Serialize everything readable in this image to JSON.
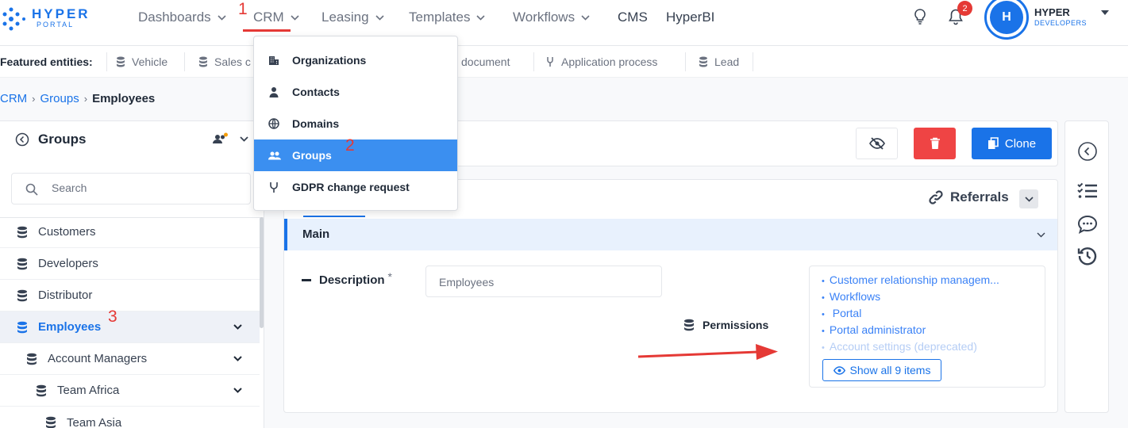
{
  "logo": {
    "title": "HYPER",
    "subtitle": "PORTAL"
  },
  "nav": {
    "dashboards": "Dashboards",
    "crm": "CRM",
    "leasing": "Leasing",
    "templates": "Templates",
    "workflows": "Workflows",
    "cms": "CMS",
    "hyperbi": "HyperBI"
  },
  "notifications": {
    "count": "2"
  },
  "user": {
    "initial": "H",
    "name": "HYPER",
    "org": "DEVELOPERS"
  },
  "featured": {
    "label": "Featured entities:",
    "items": [
      "Vehicle",
      "Sales c",
      "document",
      "Application process",
      "Lead"
    ]
  },
  "breadcrumb": [
    "CRM",
    "Groups",
    "Employees"
  ],
  "annotations": {
    "one": "1",
    "two": "2",
    "three": "3"
  },
  "crm_menu": {
    "items": [
      "Organizations",
      "Contacts",
      "Domains",
      "Groups",
      "GDPR change request"
    ],
    "active": "Groups"
  },
  "left_panel": {
    "title": "Groups",
    "search_placeholder": "Search",
    "tree": [
      "Customers",
      "Developers",
      "Distributor",
      "Employees",
      "Account Managers",
      "Team Africa",
      "Team Asia"
    ]
  },
  "toolbar": {
    "clone_label": "Clone"
  },
  "content": {
    "referrals_label": "Referrals",
    "section_title": "Main",
    "description_label": "Description",
    "required_mark": "*",
    "description_value": "Employees",
    "permissions_label": "Permissions",
    "permissions": [
      "Customer relationship managem...",
      "Workflows",
      " Portal",
      "Portal administrator",
      "Account settings (deprecated)"
    ],
    "show_all_label": "Show all 9 items"
  },
  "colors": {
    "accent": "#1a73e8",
    "danger": "#ef4444",
    "annotation": "#e53935"
  },
  "icons": [
    "lightbulb-icon",
    "bell-icon",
    "database-icon",
    "building-icon",
    "person-icon",
    "globe-icon",
    "people-icon",
    "fork-icon",
    "search-icon",
    "eye-slash-icon",
    "trash-icon",
    "copy-icon",
    "link-icon",
    "eye-icon",
    "checklist-icon",
    "chat-icon",
    "history-icon"
  ]
}
